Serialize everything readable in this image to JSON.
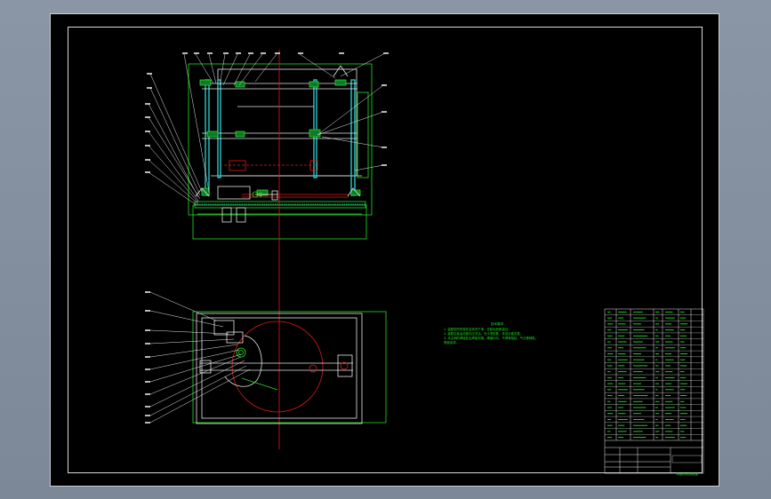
{
  "app": {
    "kind": "CAD drawing viewer",
    "background": "#7f8b9b"
  },
  "colors": {
    "sheet": "#000000",
    "frame": "#d8d8d8",
    "outline_green": "#24e024",
    "teal_part": "#28c8c8",
    "center_red": "#e01a1a",
    "text_green": "#1ce61c",
    "bracket_white": "#e6e6e6"
  },
  "technical_notes": {
    "heading": "技术要求",
    "lines": [
      "1. 装配前所有零件应清洗干净，去除毛刺和锐边。",
      "2. 装配后各运动部件应灵活，无卡滞现象，传动平稳可靠。",
      "3. 未注明的焊接处应焊接牢固，焊缝均匀，不得有裂纹、气孔等缺陷，",
      "   表面涂漆。"
    ]
  },
  "title_block": {
    "drawing_title": "转盘机构总装配图"
  },
  "leaders": {
    "front_view_callouts": 22,
    "top_view_callouts": 11
  }
}
